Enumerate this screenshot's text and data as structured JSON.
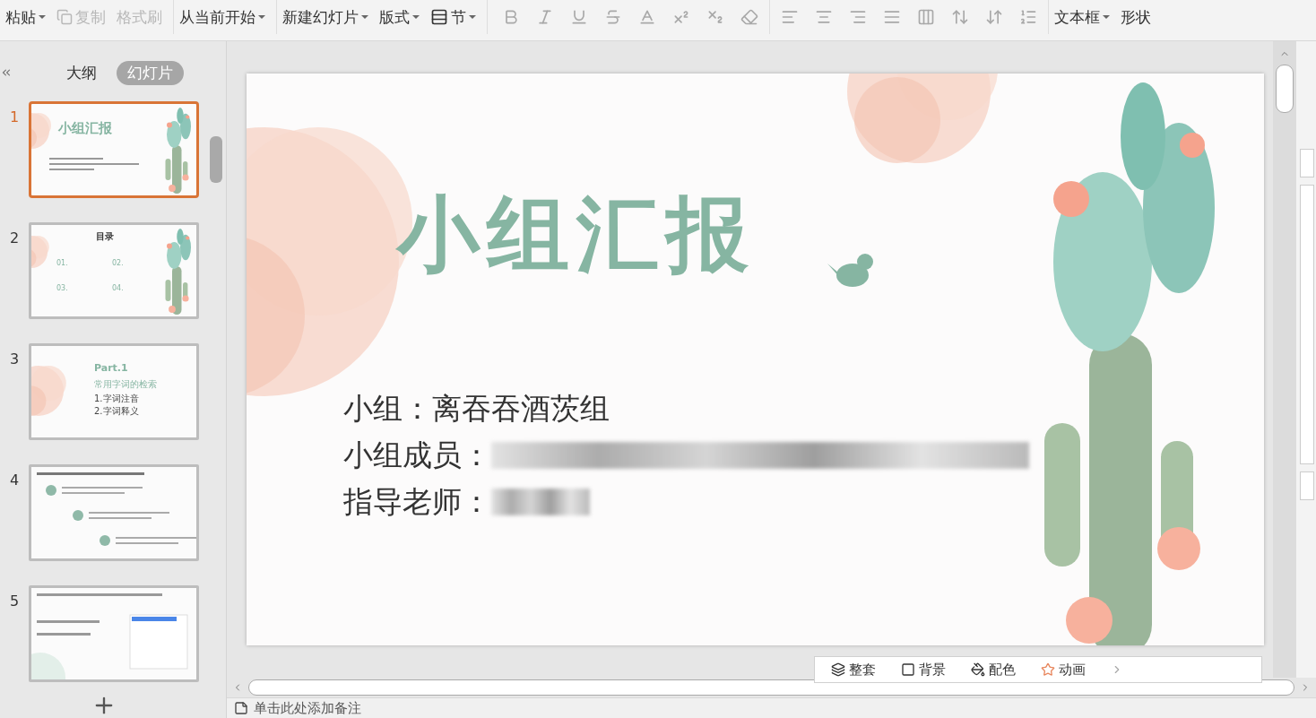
{
  "ribbon": {
    "clipboard": [
      {
        "label": "粘贴",
        "disabled": false,
        "dropdown": true
      },
      {
        "label": "复制",
        "disabled": true,
        "dropdown": false,
        "kind": "copy"
      },
      {
        "label": "格式刷",
        "disabled": true,
        "dropdown": false
      }
    ],
    "slides_group": [
      {
        "label": "从当前开始",
        "disabled": false,
        "dropdown": true
      }
    ],
    "layout_group": [
      {
        "label": "新建幻灯片",
        "disabled": false,
        "dropdown": true
      },
      {
        "label": "版式",
        "disabled": false,
        "dropdown": true
      },
      {
        "label": "节",
        "disabled": false,
        "dropdown": true,
        "kind": "section"
      }
    ],
    "insert_group": [
      {
        "label": "文本框",
        "disabled": false,
        "dropdown": true
      },
      {
        "label": "形状",
        "disabled": false,
        "dropdown": false
      }
    ]
  },
  "panel_tabs": [
    {
      "label": "大纲",
      "selected": false
    },
    {
      "label": "幻灯片",
      "selected": true
    }
  ],
  "thumbnails": [
    {
      "number": "1",
      "selected": true,
      "kind": "cover",
      "title": "小组汇报"
    },
    {
      "number": "2",
      "selected": false,
      "kind": "toc",
      "title": "目录",
      "items": [
        "01.",
        "02.",
        "03.",
        "04."
      ]
    },
    {
      "number": "3",
      "selected": false,
      "kind": "part",
      "title": "Part.1",
      "subtitle": "常用字词的检索",
      "items": [
        "1.字词注音",
        "2.字词释义"
      ]
    },
    {
      "number": "4",
      "selected": false,
      "kind": "timeline"
    },
    {
      "number": "5",
      "selected": false,
      "kind": "content"
    }
  ],
  "slide": {
    "title": "小组汇报",
    "lines": [
      {
        "label": "小组：",
        "value": "离吞吞酒茨组",
        "blurred": false
      },
      {
        "label": "小组成员：",
        "blurred": true
      },
      {
        "label": "指导老师：",
        "blurred": true
      }
    ]
  },
  "float_bar": [
    {
      "label": "整套",
      "kind": "template"
    },
    {
      "label": "背景",
      "kind": "background"
    },
    {
      "label": "配色",
      "kind": "color"
    },
    {
      "label": "动画",
      "kind": "animation"
    }
  ],
  "notes": {
    "placeholder": "单击此处添加备注"
  }
}
